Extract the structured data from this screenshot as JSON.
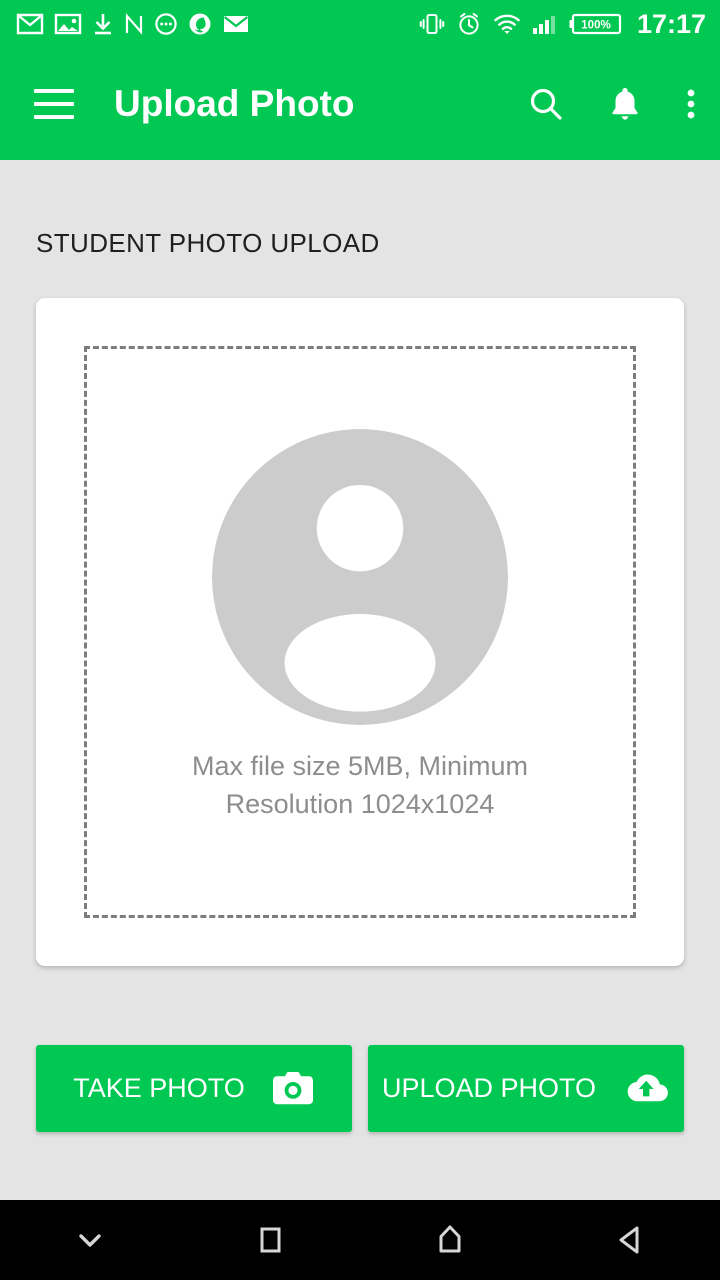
{
  "theme": {
    "accent": "#00C853",
    "background": "#e4e4e4",
    "card": "#ffffff",
    "hint_text": "#8d8d8d",
    "dashed_border": "#7d7d7d",
    "avatar_gray": "#cccccc",
    "navbar": "#000000"
  },
  "status_bar": {
    "left_icons": [
      "gmail-icon",
      "photos-icon",
      "download-icon",
      "notion-icon",
      "chat-bubble-icon",
      "bird-app-icon",
      "email-icon"
    ],
    "right_icons": [
      "vibrate-icon",
      "alarm-icon",
      "wifi-icon",
      "signal-icon",
      "battery-icon"
    ],
    "battery_level": "100%",
    "time": "17:17"
  },
  "app_bar": {
    "menu_icon": "hamburger-menu-icon",
    "title": "Upload Photo",
    "actions": [
      {
        "name": "search-icon",
        "label": "Search"
      },
      {
        "name": "notifications-icon",
        "label": "Notifications"
      },
      {
        "name": "overflow-menu-icon",
        "label": "More options"
      }
    ]
  },
  "main": {
    "section_title": "STUDENT PHOTO UPLOAD",
    "upload_card": {
      "placeholder_icon": "person-avatar-placeholder-icon",
      "hint": "Max file size 5MB, Minimum Resolution 1024x1024"
    },
    "buttons": [
      {
        "label": "TAKE PHOTO",
        "icon": "camera-icon"
      },
      {
        "label": "UPLOAD PHOTO",
        "icon": "cloud-upload-icon"
      }
    ]
  },
  "nav_bar": {
    "buttons": [
      {
        "name": "hide-keyboard-icon",
        "label": "Hide keyboard"
      },
      {
        "name": "recents-icon",
        "label": "Recents"
      },
      {
        "name": "home-icon",
        "label": "Home"
      },
      {
        "name": "back-icon",
        "label": "Back"
      }
    ]
  }
}
